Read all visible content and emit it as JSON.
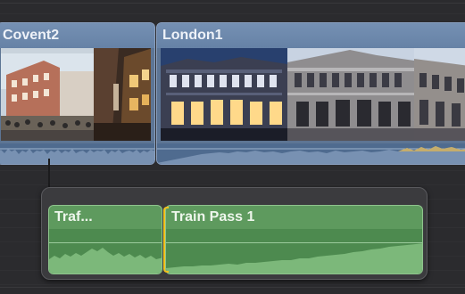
{
  "timeline": {
    "primary_clips": [
      {
        "title": "Covent2",
        "kind": "video"
      },
      {
        "title": "London1",
        "kind": "video"
      }
    ],
    "connected_clips": [
      {
        "title": "Traf...",
        "kind": "audio"
      },
      {
        "title": "Train Pass 1",
        "kind": "audio",
        "selected": true
      }
    ]
  },
  "colors": {
    "video_clip": "#5d7594",
    "audio_clip": "#5e9a5e",
    "selection": "#f2c21c",
    "background": "#2b2b2e"
  }
}
